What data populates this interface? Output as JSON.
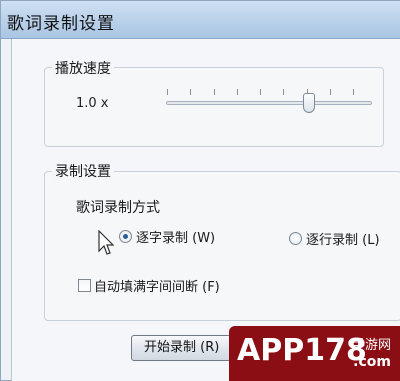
{
  "window": {
    "title": "歌词录制设置"
  },
  "playback": {
    "group_title": "播放速度",
    "speed_value": "1.0 x",
    "slider_level": 0.7
  },
  "record": {
    "group_title": "录制设置",
    "mode_label": "歌词录制方式",
    "options": [
      {
        "label": "逐字录制 (W)",
        "checked": true
      },
      {
        "label": "逐行录制 (L)",
        "checked": false
      }
    ],
    "autofill_label": "自动填满字间间断 (F)",
    "autofill_checked": false
  },
  "buttons": {
    "start": "开始录制 (R)"
  },
  "watermark": {
    "logo": "APP178",
    "sub": "手游网",
    "domain": ".com"
  }
}
